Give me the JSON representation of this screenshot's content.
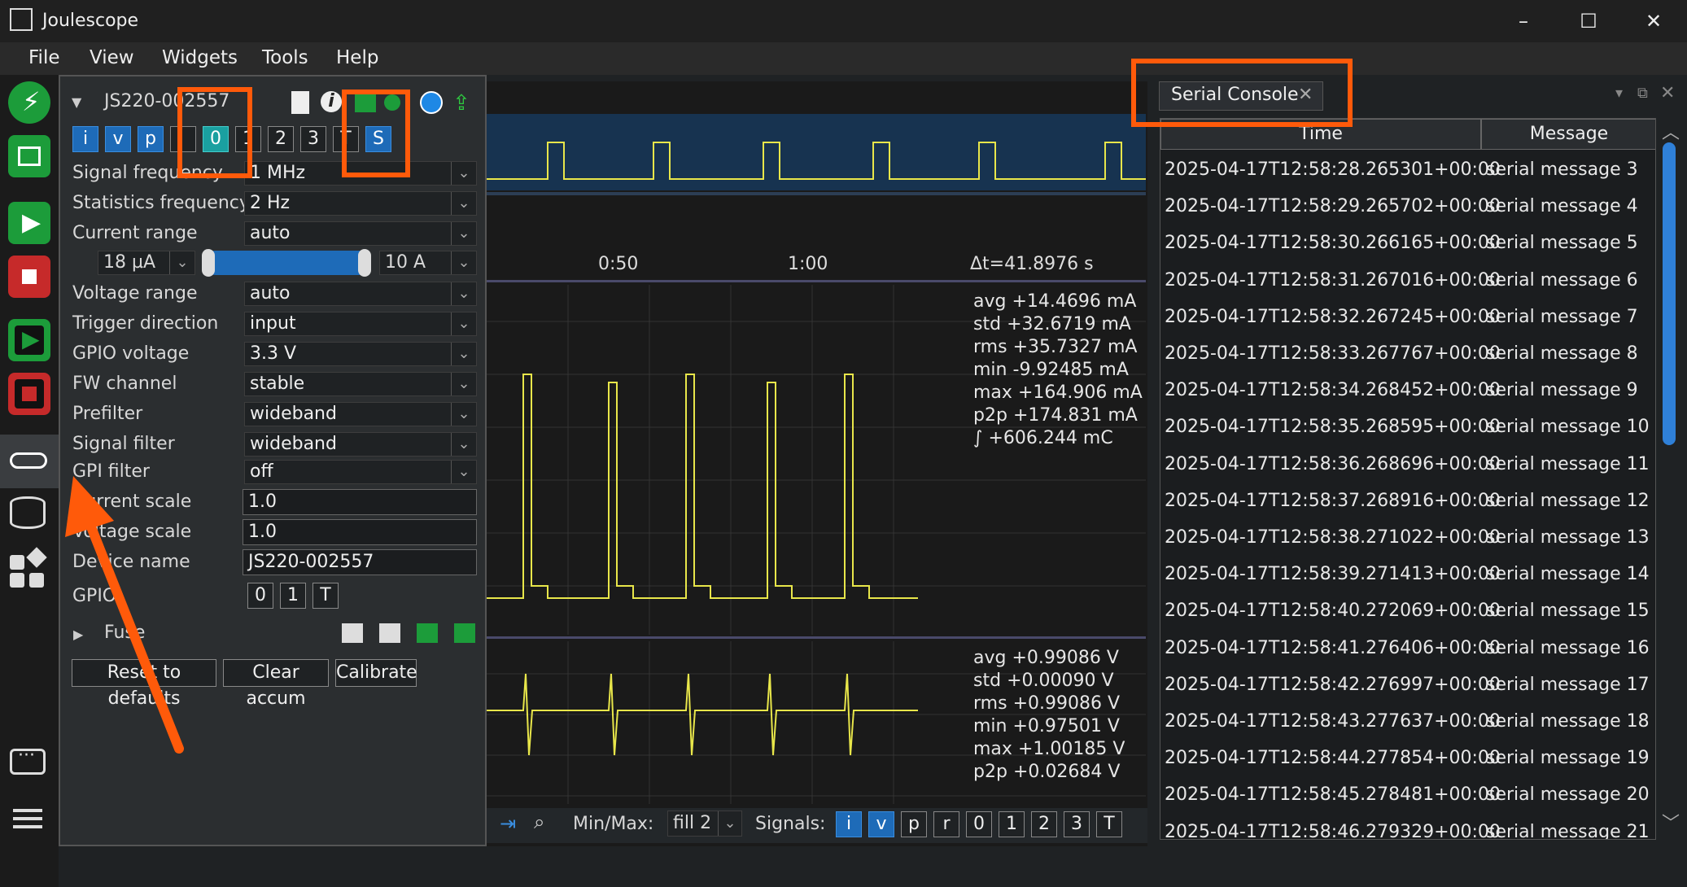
{
  "app": {
    "title": "Joulescope"
  },
  "menu": [
    "File",
    "View",
    "Widgets",
    "Tools",
    "Help"
  ],
  "device": {
    "name": "JS220-002557",
    "channel_buttons": [
      "i",
      "v",
      "p",
      "0",
      "1",
      "2",
      "3",
      "T",
      "S"
    ],
    "settings": [
      {
        "label": "Signal frequency",
        "value": "1 MHz"
      },
      {
        "label": "Statistics frequency",
        "value": "2 Hz"
      },
      {
        "label": "Current range",
        "value": "auto"
      },
      {
        "label": "Voltage range",
        "value": "auto"
      },
      {
        "label": "Trigger direction",
        "value": "input"
      },
      {
        "label": "GPIO voltage",
        "value": "3.3 V"
      },
      {
        "label": "FW channel",
        "value": "stable"
      },
      {
        "label": "Prefilter",
        "value": "wideband"
      },
      {
        "label": "Signal filter",
        "value": "wideband"
      },
      {
        "label": "GPI filter",
        "value": "off"
      }
    ],
    "range_min": "18 µA",
    "range_max": "10 A",
    "current_scale_label": "Current scale",
    "current_scale": "1.0",
    "voltage_scale_label": "Voltage scale",
    "voltage_scale": "1.0",
    "device_name_label": "Device name",
    "device_name_value": "JS220-002557",
    "gpio_label": "GPIO",
    "gpio_buttons": [
      "0",
      "1",
      "T"
    ],
    "fuse_label": "Fuse",
    "buttons": [
      "Reset to defaults",
      "Clear accum",
      "Calibrate"
    ]
  },
  "waveform": {
    "time_labels": [
      "0:50",
      "1:00"
    ],
    "delta_t": "Δt=41.8976 s",
    "current_stats": [
      {
        "name": "avg",
        "value": "+14.4696",
        "unit": "mA"
      },
      {
        "name": "std",
        "value": "+32.6719",
        "unit": "mA"
      },
      {
        "name": "rms",
        "value": "+35.7327",
        "unit": "mA"
      },
      {
        "name": "min",
        "value": "-9.92485",
        "unit": "mA"
      },
      {
        "name": "max",
        "value": "+164.906",
        "unit": "mA"
      },
      {
        "name": "p2p",
        "value": "+174.831",
        "unit": "mA"
      },
      {
        "name": "∫",
        "value": "+606.244",
        "unit": "mC"
      }
    ],
    "voltage_stats": [
      {
        "name": "avg",
        "value": "+0.99086",
        "unit": "V"
      },
      {
        "name": "std",
        "value": "+0.00090",
        "unit": "V"
      },
      {
        "name": "rms",
        "value": "+0.99086",
        "unit": "V"
      },
      {
        "name": "min",
        "value": "+0.97501",
        "unit": "V"
      },
      {
        "name": "max",
        "value": "+1.00185",
        "unit": "V"
      },
      {
        "name": "p2p",
        "value": "+0.02684",
        "unit": "V"
      }
    ],
    "minmax_label": "Min/Max:",
    "minmax_value": "fill 2",
    "signals_label": "Signals:",
    "signal_buttons": [
      "i",
      "v",
      "p",
      "r",
      "0",
      "1",
      "2",
      "3",
      "T"
    ]
  },
  "console": {
    "tab": "Serial Console",
    "col_time": "Time",
    "col_message": "Message",
    "rows": [
      {
        "time": "2025-04-17T12:58:28.265301+00:00",
        "msg": "serial message 3"
      },
      {
        "time": "2025-04-17T12:58:29.265702+00:00",
        "msg": "serial message 4"
      },
      {
        "time": "2025-04-17T12:58:30.266165+00:00",
        "msg": "serial message 5"
      },
      {
        "time": "2025-04-17T12:58:31.267016+00:00",
        "msg": "serial message 6"
      },
      {
        "time": "2025-04-17T12:58:32.267245+00:00",
        "msg": "serial message 7"
      },
      {
        "time": "2025-04-17T12:58:33.267767+00:00",
        "msg": "serial message 8"
      },
      {
        "time": "2025-04-17T12:58:34.268452+00:00",
        "msg": "serial message 9"
      },
      {
        "time": "2025-04-17T12:58:35.268595+00:00",
        "msg": "serial message 10"
      },
      {
        "time": "2025-04-17T12:58:36.268696+00:00",
        "msg": "serial message 11"
      },
      {
        "time": "2025-04-17T12:58:37.268916+00:00",
        "msg": "serial message 12"
      },
      {
        "time": "2025-04-17T12:58:38.271022+00:00",
        "msg": "serial message 13"
      },
      {
        "time": "2025-04-17T12:58:39.271413+00:00",
        "msg": "serial message 14"
      },
      {
        "time": "2025-04-17T12:58:40.272069+00:00",
        "msg": "serial message 15"
      },
      {
        "time": "2025-04-17T12:58:41.276406+00:00",
        "msg": "serial message 16"
      },
      {
        "time": "2025-04-17T12:58:42.276997+00:00",
        "msg": "serial message 17"
      },
      {
        "time": "2025-04-17T12:58:43.277637+00:00",
        "msg": "serial message 18"
      },
      {
        "time": "2025-04-17T12:58:44.277854+00:00",
        "msg": "serial message 19"
      },
      {
        "time": "2025-04-17T12:58:45.278481+00:00",
        "msg": "serial message 20"
      },
      {
        "time": "2025-04-17T12:58:46.279329+00:00",
        "msg": "serial message 21"
      }
    ]
  },
  "colors": {
    "accent": "#1e6bb8",
    "trace": "#e8e64a",
    "annotation": "#ff5a0a"
  }
}
